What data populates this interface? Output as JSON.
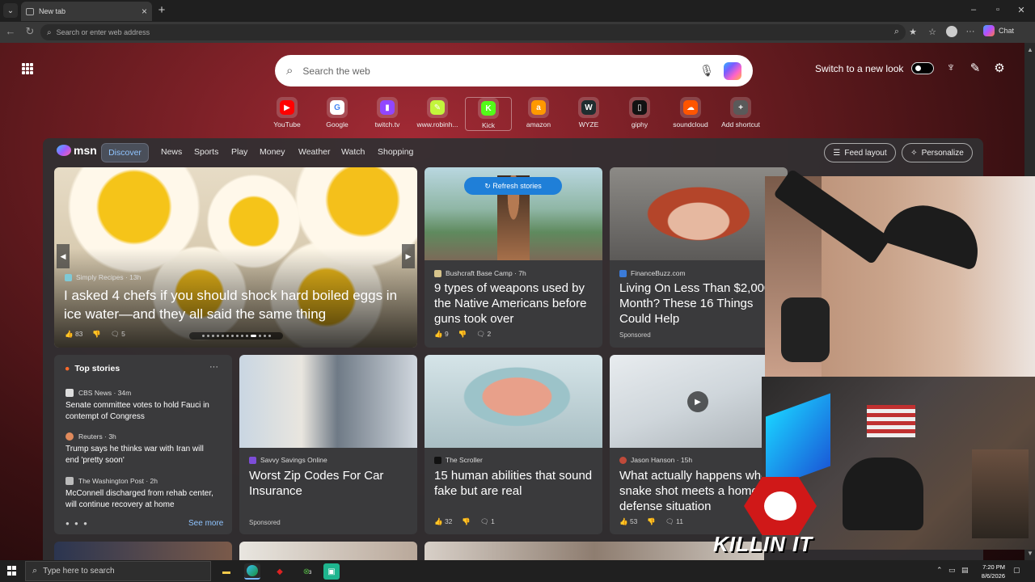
{
  "browser": {
    "tab_title": "New tab",
    "address_placeholder": "Search or enter web address",
    "chat_label": "Chat"
  },
  "newtab": {
    "search_placeholder": "Search the web",
    "switch_look_label": "Switch to a new look",
    "shortcuts": [
      {
        "label": "YouTube",
        "icon": "youtube-icon",
        "color": "#ff0000",
        "glyph": "▶"
      },
      {
        "label": "Google",
        "icon": "google-icon",
        "color": "#ffffff",
        "glyph": "G"
      },
      {
        "label": "twitch.tv",
        "icon": "twitch-icon",
        "color": "#9146ff",
        "glyph": "▮"
      },
      {
        "label": "www.robinh...",
        "icon": "robinhood-icon",
        "color": "#c3f53c",
        "glyph": "✎"
      },
      {
        "label": "Kick",
        "icon": "kick-icon",
        "color": "#53fc18",
        "glyph": "K"
      },
      {
        "label": "amazon",
        "icon": "amazon-icon",
        "color": "#ff9900",
        "glyph": "a"
      },
      {
        "label": "WYZE",
        "icon": "wyze-icon",
        "color": "#1f2d2f",
        "glyph": "W"
      },
      {
        "label": "giphy",
        "icon": "giphy-icon",
        "color": "#121212",
        "glyph": "▯"
      },
      {
        "label": "soundcloud",
        "icon": "soundcloud-icon",
        "color": "#ff5500",
        "glyph": "☁"
      },
      {
        "label": "Add shortcut",
        "icon": "plus-icon",
        "color": "#5a5a5a",
        "glyph": "+"
      }
    ]
  },
  "msn": {
    "logo": "msn",
    "nav": [
      "Discover",
      "News",
      "Sports",
      "Play",
      "Money",
      "Weather",
      "Watch",
      "Shopping"
    ],
    "feed_layout": "Feed layout",
    "personalize": "Personalize",
    "refresh": "Refresh stories",
    "hero": {
      "source": "Simply Recipes",
      "age": "13h",
      "title": "I asked 4 chefs if you should shock hard boiled eggs in ice water—and they all said the same thing",
      "likes": "83",
      "comments": "5"
    },
    "card_weapons": {
      "source": "Bushcraft Base Camp",
      "age": "7h",
      "title": "9 types of weapons used by the Native Americans before guns took over",
      "likes": "9",
      "comments": "2"
    },
    "card_finance": {
      "source": "FinanceBuzz.com",
      "title": "Living On Less Than $2,000 a Month? These 16 Things Could Help",
      "sponsored": "Sponsored"
    },
    "top_stories": {
      "title": "Top stories",
      "items": [
        {
          "source": "CBS News",
          "age": "34m",
          "headline": "Senate committee votes to hold Fauci in contempt of Congress"
        },
        {
          "source": "Reuters",
          "age": "3h",
          "headline": "Trump says he thinks war with Iran will end 'pretty soon'"
        },
        {
          "source": "The Washington Post",
          "age": "2h",
          "headline": "McConnell discharged from rehab center, will continue recovery at home"
        }
      ],
      "see_more": "See more"
    },
    "card_zip": {
      "source": "Savvy Savings Online",
      "title": "Worst Zip Codes For Car Insurance",
      "sponsored": "Sponsored"
    },
    "card_abilities": {
      "source": "The Scroller",
      "title": "15 human abilities that sound fake but are real",
      "likes": "32",
      "comments": "1"
    },
    "card_snake": {
      "source": "Jason Hanson",
      "age": "15h",
      "title": "What actually happens when a snake shot meets a home defense situation",
      "likes": "53",
      "comments": "11"
    }
  },
  "overlay": {
    "brand": "KILLIN IT"
  },
  "taskbar": {
    "search_placeholder": "Type here to search",
    "time": "7:20 PM",
    "date": "8/6/2026",
    "xbox_badge": "3"
  }
}
